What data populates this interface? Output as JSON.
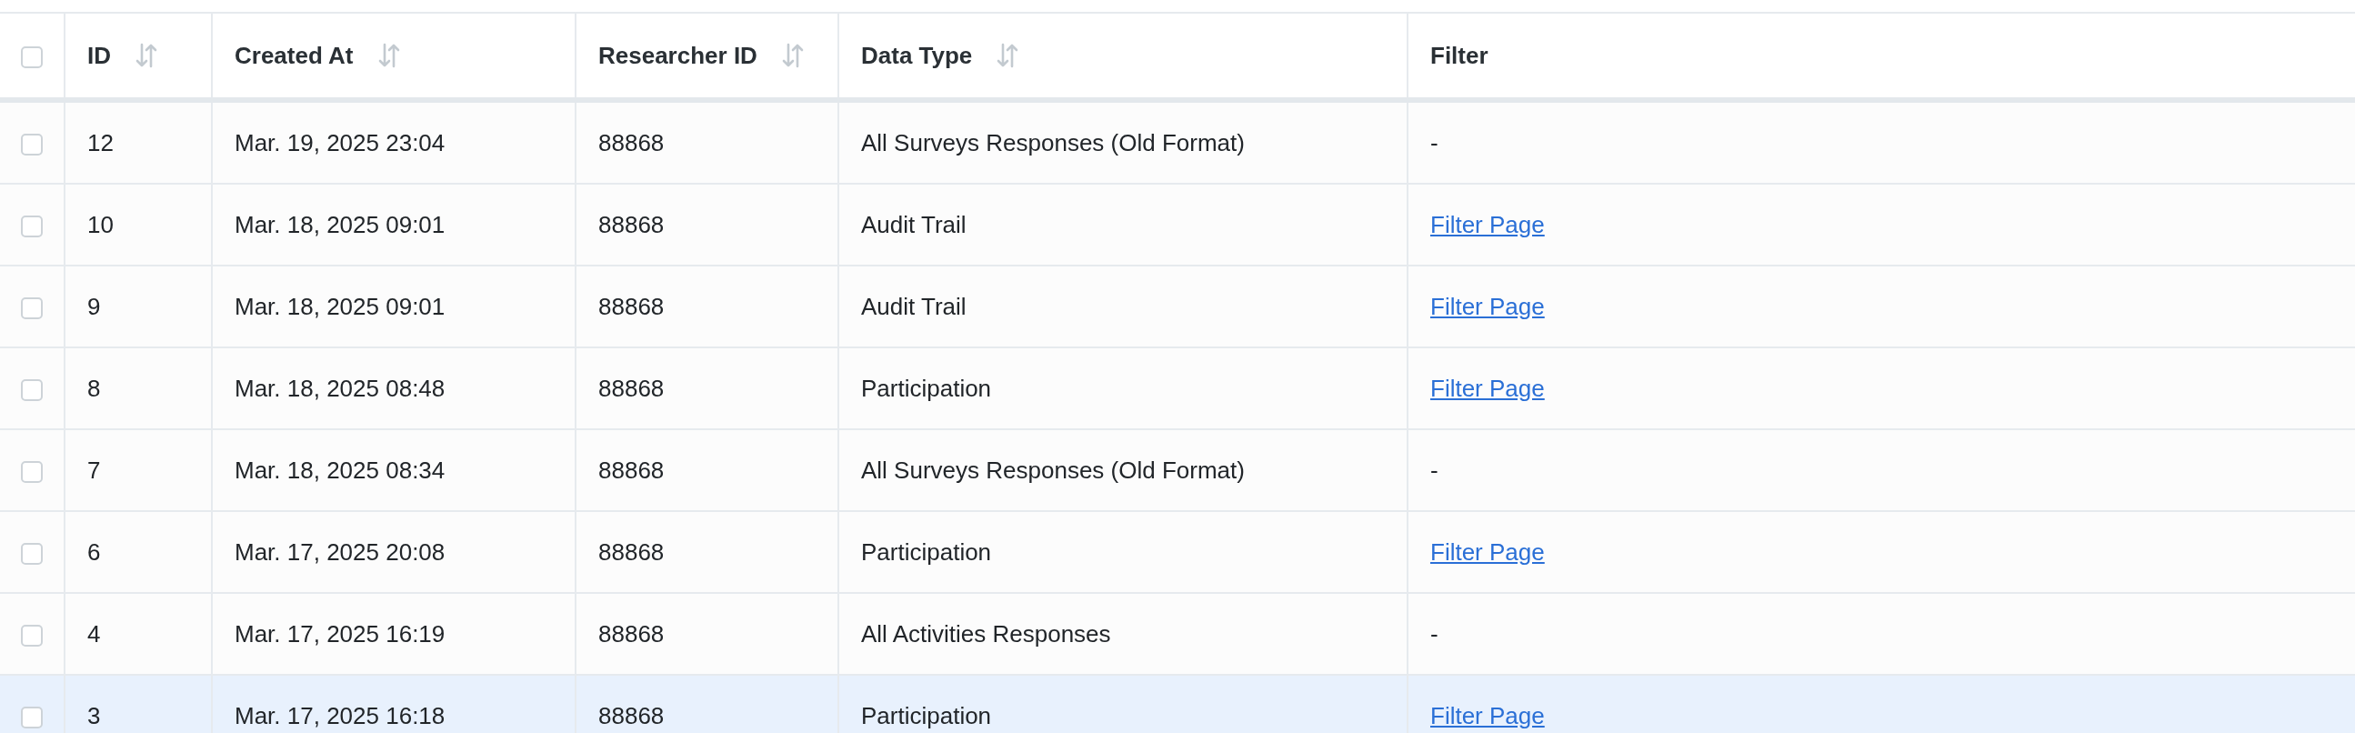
{
  "table": {
    "select_all": {
      "checked": false
    },
    "columns": [
      {
        "label": "ID",
        "sortable": true
      },
      {
        "label": "Created At",
        "sortable": true
      },
      {
        "label": "Researcher ID",
        "sortable": true
      },
      {
        "label": "Data Type",
        "sortable": true
      },
      {
        "label": "Filter",
        "sortable": false
      }
    ],
    "rows": [
      {
        "checked": false,
        "highlighted": false,
        "cells": [
          "12",
          "Mar. 19, 2025 23:04",
          "88868",
          "All Surveys Responses (Old Format)"
        ],
        "filter": {
          "kind": "text",
          "text": "-"
        }
      },
      {
        "checked": false,
        "highlighted": false,
        "cells": [
          "10",
          "Mar. 18, 2025 09:01",
          "88868",
          "Audit Trail"
        ],
        "filter": {
          "kind": "link",
          "text": "Filter Page"
        }
      },
      {
        "checked": false,
        "highlighted": false,
        "cells": [
          "9",
          "Mar. 18, 2025 09:01",
          "88868",
          "Audit Trail"
        ],
        "filter": {
          "kind": "link",
          "text": "Filter Page"
        }
      },
      {
        "checked": false,
        "highlighted": false,
        "cells": [
          "8",
          "Mar. 18, 2025 08:48",
          "88868",
          "Participation"
        ],
        "filter": {
          "kind": "link",
          "text": "Filter Page"
        }
      },
      {
        "checked": false,
        "highlighted": false,
        "cells": [
          "7",
          "Mar. 18, 2025 08:34",
          "88868",
          "All Surveys Responses (Old Format)"
        ],
        "filter": {
          "kind": "text",
          "text": "-"
        }
      },
      {
        "checked": false,
        "highlighted": false,
        "cells": [
          "6",
          "Mar. 17, 2025 20:08",
          "88868",
          "Participation"
        ],
        "filter": {
          "kind": "link",
          "text": "Filter Page"
        }
      },
      {
        "checked": false,
        "highlighted": false,
        "cells": [
          "4",
          "Mar. 17, 2025 16:19",
          "88868",
          "All Activities Responses"
        ],
        "filter": {
          "kind": "text",
          "text": "-"
        }
      },
      {
        "checked": false,
        "highlighted": true,
        "cells": [
          "3",
          "Mar. 17, 2025 16:18",
          "88868",
          "Participation"
        ],
        "filter": {
          "kind": "link",
          "text": "Filter Page"
        }
      }
    ]
  }
}
